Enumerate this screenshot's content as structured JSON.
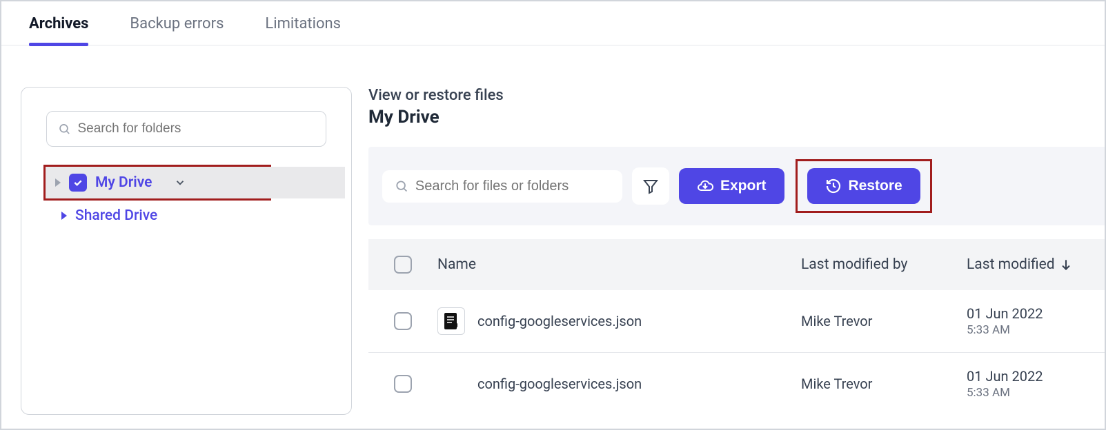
{
  "tabs": [
    "Archives",
    "Backup errors",
    "Limitations"
  ],
  "active_tab": 0,
  "sidebar": {
    "search_placeholder": "Search for folders",
    "items": [
      {
        "label": "My Drive",
        "checked": true,
        "expandable": true
      },
      {
        "label": "Shared Drive",
        "checked": false,
        "expandable": true
      }
    ]
  },
  "content": {
    "view_label": "View or restore files",
    "title": "My Drive",
    "file_search_placeholder": "Search for files or folders",
    "export_label": "Export",
    "restore_label": "Restore"
  },
  "table": {
    "columns": [
      "Name",
      "Last modified by",
      "Last modified"
    ],
    "rows": [
      {
        "name": "config-googleservices.json",
        "modified_by": "Mike Trevor",
        "date": "01 Jun 2022",
        "time": "5:33 AM"
      },
      {
        "name": "config-googleservices.json",
        "modified_by": "Mike Trevor",
        "date": "01 Jun 2022",
        "time": "5:33 AM"
      }
    ]
  }
}
